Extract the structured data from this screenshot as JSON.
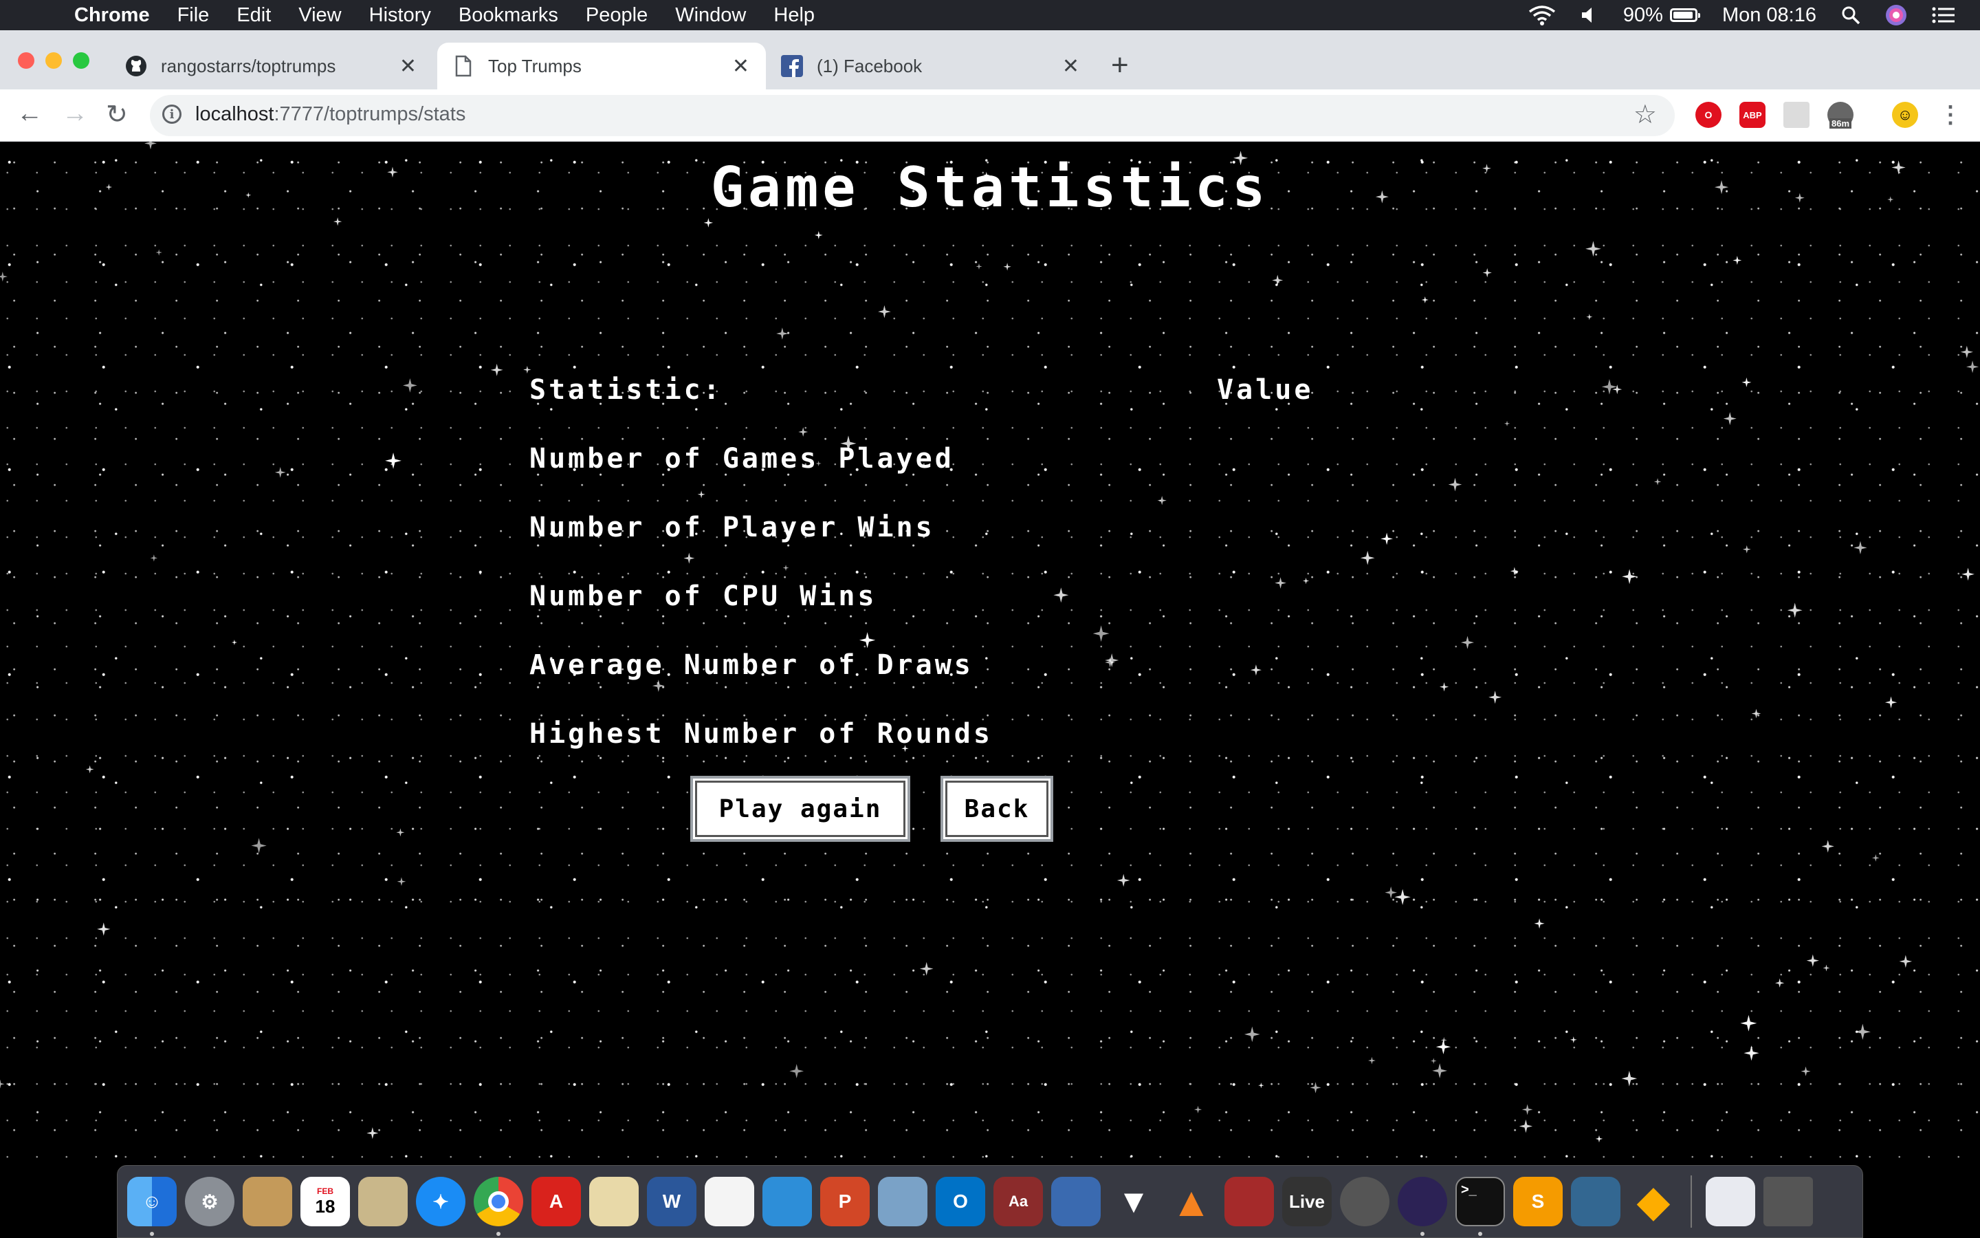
{
  "menubar": {
    "app": "Chrome",
    "menus": [
      "File",
      "Edit",
      "View",
      "History",
      "Bookmarks",
      "People",
      "Window",
      "Help"
    ],
    "battery": "90%",
    "clock": "Mon 08:16"
  },
  "tabs": [
    {
      "title": "rangostarrs/toptrumps",
      "icon": "github-icon"
    },
    {
      "title": "Top Trumps",
      "icon": "page-icon",
      "active": true
    },
    {
      "title": "(1) Facebook",
      "icon": "facebook-icon"
    }
  ],
  "toolbar": {
    "url_host": "localhost",
    "url_rest": ":7777/toptrumps/stats",
    "ext_badge": "86m"
  },
  "page": {
    "title": "Game Statistics",
    "table": {
      "header_statistic": "Statistic:",
      "header_value": "Value",
      "rows": [
        "Number of Games Played",
        "Number of Player Wins",
        "Number of CPU Wins",
        "Average Number of Draws",
        "Highest Number of Rounds"
      ]
    },
    "play_again_label": "Play again",
    "back_label": "Back"
  },
  "dock": {
    "calendar_month": "FEB",
    "calendar_day": "18",
    "live_label": "Live"
  },
  "colors": {
    "menubar": "#23252b",
    "tabstrip": "#dee1e6",
    "page_bg": "#000000",
    "text": "#ffffff"
  }
}
